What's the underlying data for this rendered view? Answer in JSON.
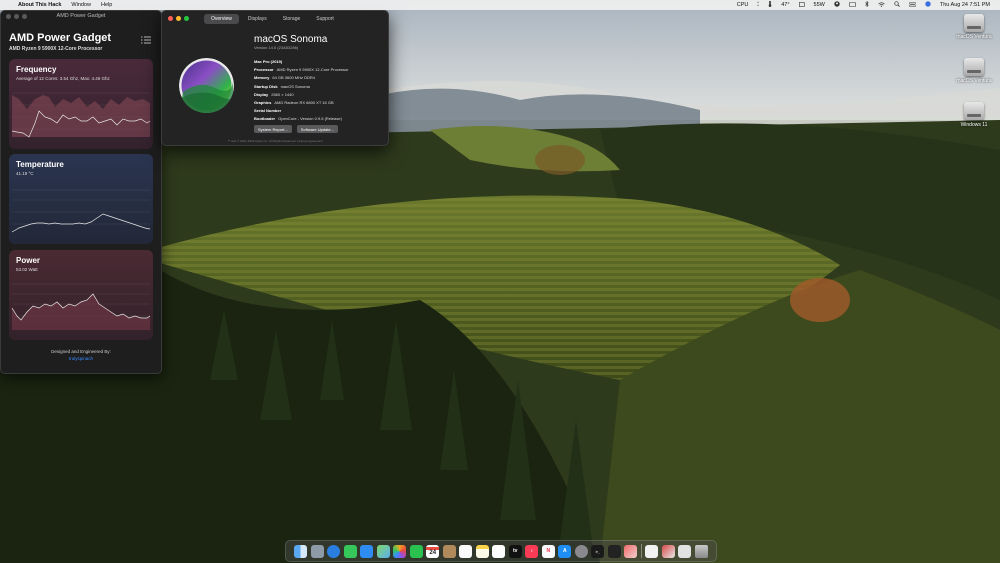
{
  "menubar": {
    "apple_glyph": "",
    "app_name": "About This Hack",
    "menus": [
      "Window",
      "Help"
    ],
    "cpu_label": "CPU",
    "temp": "47°",
    "power": "55W",
    "datetime": "Thu Aug 24  7:51 PM"
  },
  "gadget": {
    "window_title": "AMD Power Gadget",
    "title": "AMD Power Gadget",
    "cpu": "AMD Ryzen 9 5900X 12-Core Processor",
    "frequency": {
      "title": "Frequency",
      "subtitle": "Average of 12 Cores: 3.54 Ghz, Max: 4.46 Ghz"
    },
    "temperature": {
      "title": "Temperature",
      "subtitle": "41.19 °C"
    },
    "power": {
      "title": "Power",
      "subtitle": "53.02 Watt"
    },
    "credit": "Designed and Engineered By:",
    "author": "trulyspinach"
  },
  "about": {
    "tabs": [
      "Overview",
      "Displays",
      "Storage",
      "Support"
    ],
    "active_tab": "Overview",
    "os_name": "macOS Sonoma",
    "os_version": "Version 14.0 (23A5328b)",
    "model": "Mac Pro (2019)",
    "specs": [
      {
        "k": "Processor",
        "v": "AMD Ryzen 9 5900X 12-Core Processor"
      },
      {
        "k": "Memory",
        "v": "64 GB 3600 MHz DDR4"
      },
      {
        "k": "Startup Disk",
        "v": "macOS Sonoma"
      },
      {
        "k": "Display",
        "v": "2560 × 1440"
      },
      {
        "k": "Graphics",
        "v": "AMD Radeon RX 6800 XT 16 GB"
      },
      {
        "k": "Serial Number",
        "v": ""
      },
      {
        "k": "Bootloader",
        "v": "OpenCore - Version 0.9.5 (Release)"
      }
    ],
    "buttons": [
      "System Report...",
      "Software Update..."
    ],
    "copyright": "™ and © 2001-2023 Apple Inc. All Rights Reserved. License Agreement"
  },
  "desktop_icons": [
    {
      "label": "macOS Ventura",
      "icon": "hard-drive-icon"
    },
    {
      "label": "macOS Ventura",
      "icon": "hard-drive-icon"
    },
    {
      "label": "Windows 11",
      "icon": "hard-drive-icon"
    }
  ],
  "dock": {
    "calendar_day": "24",
    "apps": [
      "finder",
      "launchpad",
      "safari",
      "messages",
      "mail",
      "maps",
      "photos",
      "facetime",
      "calendar",
      "contacts",
      "reminders",
      "notes",
      "freeform",
      "tv",
      "music",
      "news",
      "app-store",
      "system-settings",
      "terminal",
      "activity-monitor",
      "brush",
      "downloads",
      "preview",
      "trash"
    ]
  },
  "colors": {
    "accent": "#3a8cff",
    "close": "#ff5f57",
    "minimize": "#febc2e",
    "zoom": "#28c840"
  }
}
